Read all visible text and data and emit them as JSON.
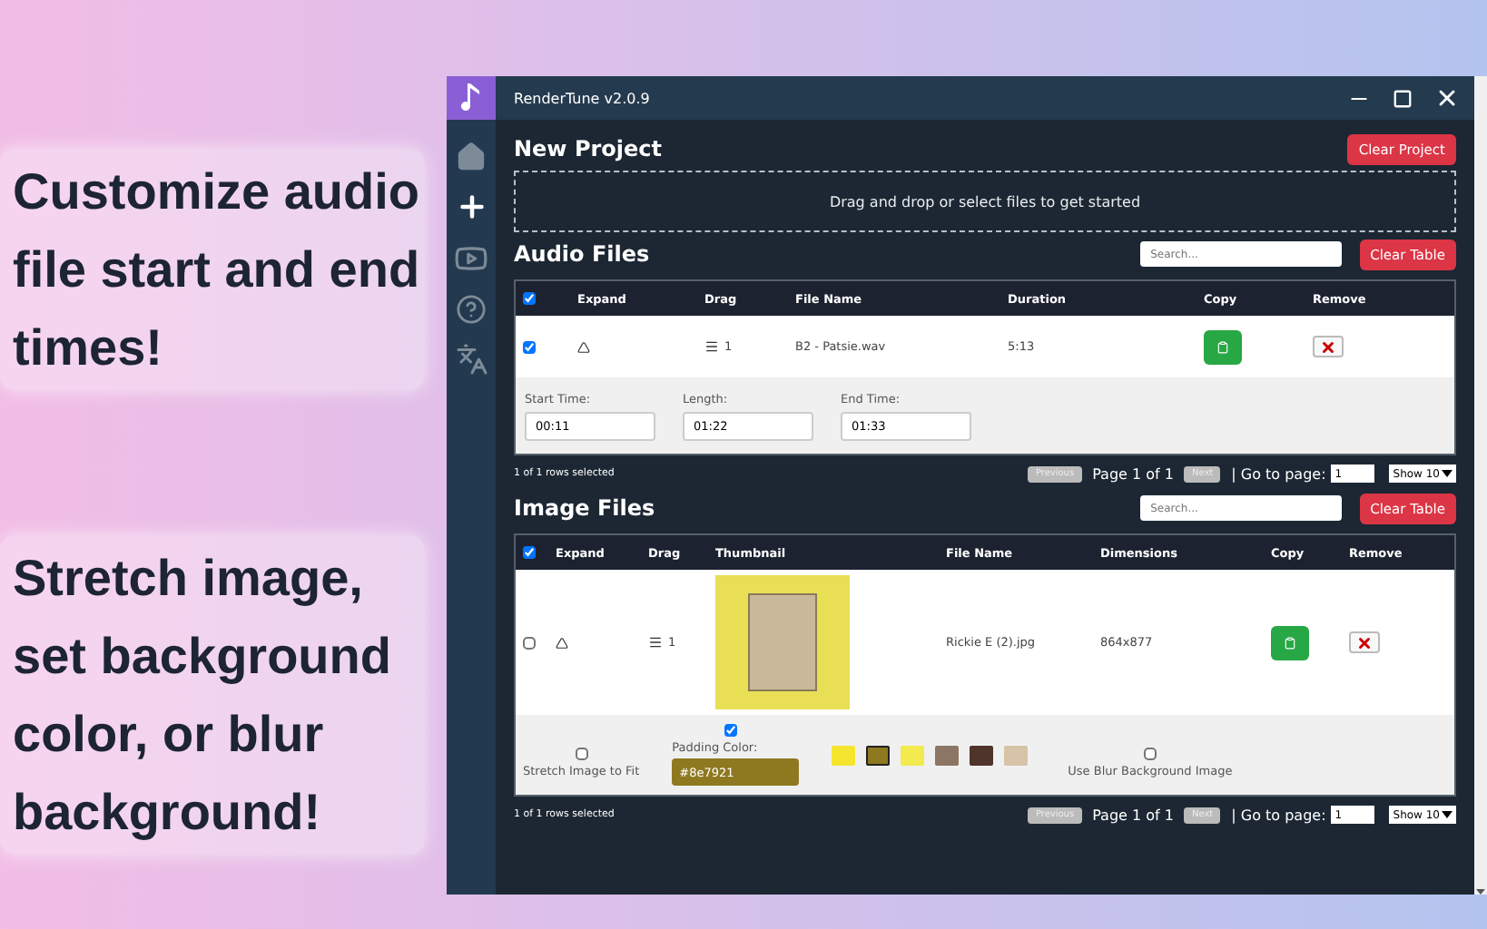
{
  "captions": [
    "Customize audio file start and end times!",
    "Stretch image, set background color, or blur background!"
  ],
  "window": {
    "title": "RenderTune v2.0.9"
  },
  "project": {
    "heading": "New Project",
    "clear_button": "Clear Project",
    "dropzone": "Drag and drop or select files to get started"
  },
  "audio": {
    "heading": "Audio Files",
    "search_placeholder": "Search...",
    "clear_button": "Clear Table",
    "all_checked": true,
    "columns": [
      "Expand",
      "Drag",
      "File Name",
      "Duration",
      "Copy",
      "Remove"
    ],
    "rows": [
      {
        "checked": true,
        "expanded": true,
        "order": "1",
        "file_name": "B2 - Patsie.wav",
        "duration": "5:13",
        "fields": [
          {
            "label": "Start Time:",
            "value": "00:11"
          },
          {
            "label": "Length:",
            "value": "01:22"
          },
          {
            "label": "End Time:",
            "value": "01:33"
          }
        ]
      }
    ],
    "footer": {
      "selected": "1 of 1 rows selected",
      "previous": "Previous",
      "page": "Page 1 of 1",
      "next": "Next",
      "goto": "| Go to page:",
      "goto_value": "1",
      "show": "Show 10"
    }
  },
  "images": {
    "heading": "Image Files",
    "search_placeholder": "Search...",
    "clear_button": "Clear Table",
    "all_checked": true,
    "columns": [
      "Expand",
      "Drag",
      "Thumbnail",
      "File Name",
      "Dimensions",
      "Copy",
      "Remove"
    ],
    "rows": [
      {
        "checked": false,
        "expanded": true,
        "order": "1",
        "file_name": "Rickie E (2).jpg",
        "dimensions": "864x877",
        "stretch": {
          "label": "Stretch Image to Fit",
          "checked": false
        },
        "padding": {
          "label": "Padding Color:",
          "checked": true,
          "value": "#8e7921"
        },
        "swatches": [
          {
            "color": "#f5e52f",
            "selected": false
          },
          {
            "color": "#8e7921",
            "selected": true
          },
          {
            "color": "#f3ea4f",
            "selected": false
          },
          {
            "color": "#8c7563",
            "selected": false
          },
          {
            "color": "#4f342c",
            "selected": false
          },
          {
            "color": "#d6c3a8",
            "selected": false
          }
        ],
        "blur": {
          "label": "Use Blur Background Image",
          "checked": false
        }
      }
    ],
    "footer": {
      "selected": "1 of 1 rows selected",
      "previous": "Previous",
      "page": "Page 1 of 1",
      "next": "Next",
      "goto": "| Go to page:",
      "goto_value": "1",
      "show": "Show 10"
    }
  }
}
